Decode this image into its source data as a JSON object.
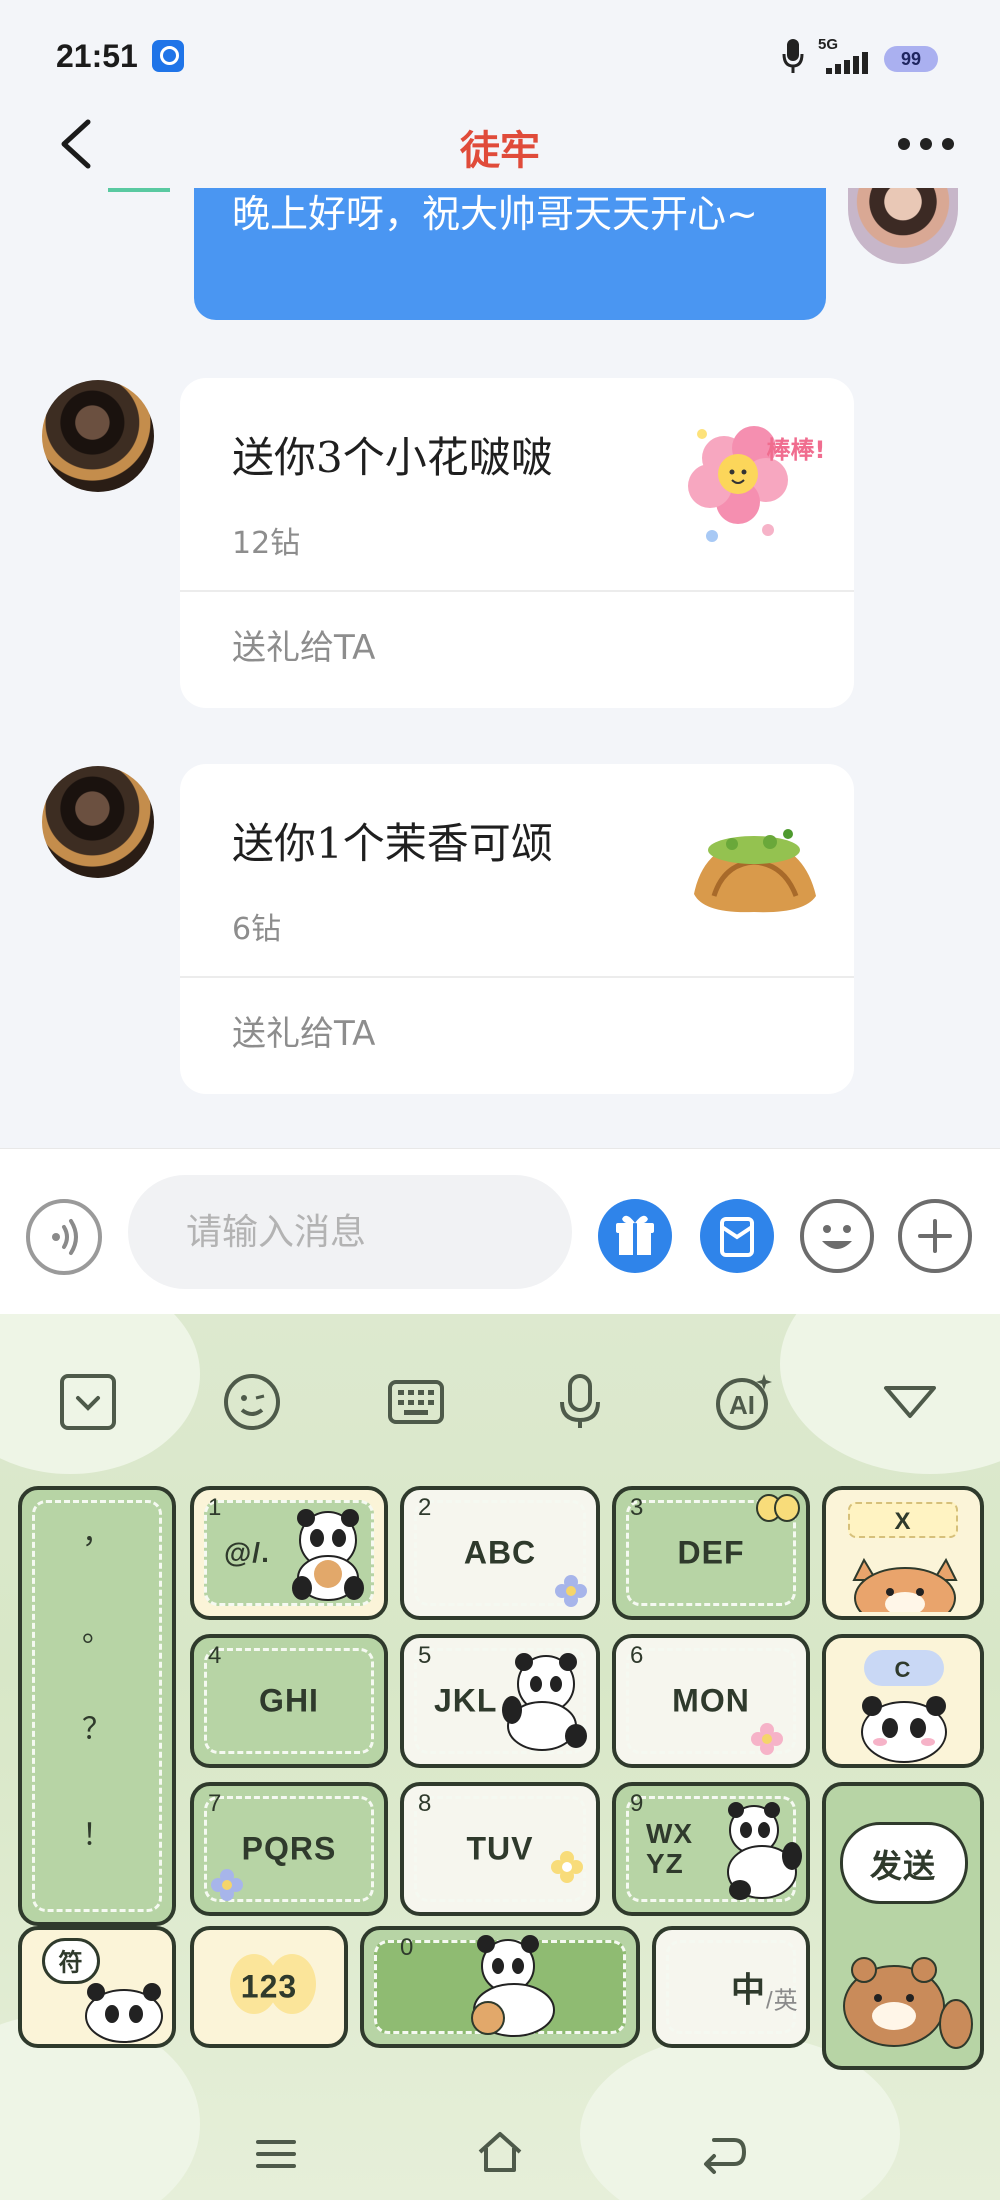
{
  "status_bar": {
    "time": "21:51",
    "network": "5G",
    "battery": "99"
  },
  "header": {
    "title": "徒牢"
  },
  "chat": {
    "my_message": "晚上好呀，祝大帅哥天天开心~",
    "gifts": [
      {
        "title": "送你3个小花啵啵",
        "price": "12钻",
        "action": "送礼给TA",
        "sticker_text": "棒棒!"
      },
      {
        "title": "送你1个茉香可颂",
        "price": "6钻",
        "action": "送礼给TA"
      }
    ]
  },
  "input_bar": {
    "placeholder": "请输入消息"
  },
  "keyboard": {
    "punctuation": [
      "，",
      "。",
      "？",
      "！"
    ],
    "keys": [
      {
        "num": "1",
        "label": "@/."
      },
      {
        "num": "2",
        "label": "ABC"
      },
      {
        "num": "3",
        "label": "DEF"
      },
      {
        "num": "4",
        "label": "GHI"
      },
      {
        "num": "5",
        "label": "JKL"
      },
      {
        "num": "6",
        "label": "MON"
      },
      {
        "num": "7",
        "label": "PQRS"
      },
      {
        "num": "8",
        "label": "TUV"
      },
      {
        "num": "9",
        "label": "WX YZ"
      }
    ],
    "delete_label": "X",
    "clear_label": "C",
    "send_label": "发送",
    "symbols_label": "符",
    "numbers_label": "123",
    "zero_label": "0",
    "lang_main": "中",
    "lang_alt": "/英"
  }
}
